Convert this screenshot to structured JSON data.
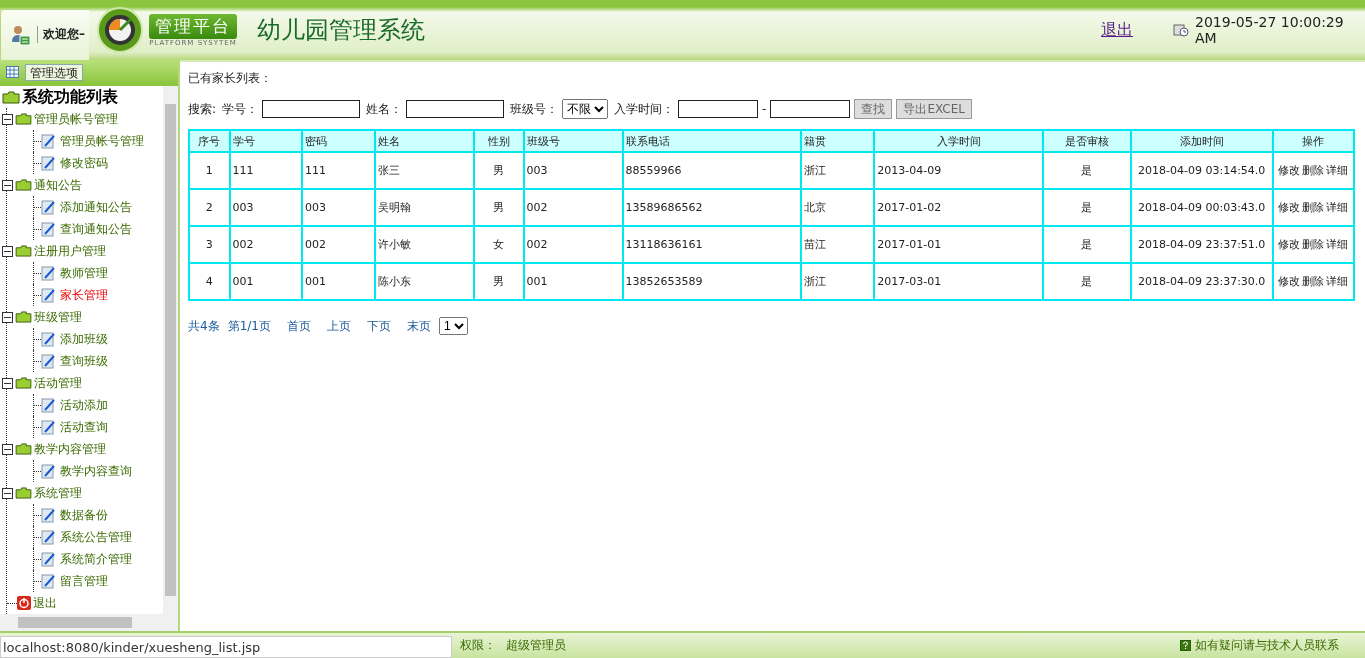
{
  "header": {
    "welcome": "欢迎您–",
    "logo_title": "管理平台",
    "logo_subtitle": "PLATFORM SYSYTEM",
    "app_title": "幼儿园管理系统",
    "logout": "退出",
    "datetime": "2019-05-27 10:00:29 AM"
  },
  "sidebar": {
    "tab": "管理选项",
    "tree": {
      "label": "系统功能列表",
      "children": [
        {
          "kind": "group",
          "label": "管理员帐号管理",
          "expanded": true,
          "children": [
            {
              "label": "管理员帐号管理",
              "selected": false
            },
            {
              "label": "修改密码",
              "selected": false
            }
          ]
        },
        {
          "kind": "group",
          "label": "通知公告",
          "expanded": true,
          "children": [
            {
              "label": "添加通知公告",
              "selected": false
            },
            {
              "label": "查询通知公告",
              "selected": false
            }
          ]
        },
        {
          "kind": "group",
          "label": "注册用户管理",
          "expanded": true,
          "children": [
            {
              "label": "教师管理",
              "selected": false
            },
            {
              "label": "家长管理",
              "selected": true
            }
          ]
        },
        {
          "kind": "group",
          "label": "班级管理",
          "expanded": true,
          "children": [
            {
              "label": "添加班级",
              "selected": false
            },
            {
              "label": "查询班级",
              "selected": false
            }
          ]
        },
        {
          "kind": "group",
          "label": "活动管理",
          "expanded": true,
          "children": [
            {
              "label": "活动添加",
              "selected": false
            },
            {
              "label": "活动查询",
              "selected": false
            }
          ]
        },
        {
          "kind": "group",
          "label": "教学内容管理",
          "expanded": true,
          "children": [
            {
              "label": "教学内容查询",
              "selected": false
            }
          ]
        },
        {
          "kind": "group",
          "label": "系统管理",
          "expanded": true,
          "children": [
            {
              "label": "数据备份",
              "selected": false
            },
            {
              "label": "系统公告管理",
              "selected": false
            },
            {
              "label": "系统简介管理",
              "selected": false
            },
            {
              "label": "留言管理",
              "selected": false
            }
          ]
        },
        {
          "kind": "exit",
          "label": "退出",
          "selected": false
        }
      ]
    }
  },
  "content": {
    "heading": "已有家长列表：",
    "search": {
      "label": "搜索:",
      "fields": [
        {
          "label": "学号：",
          "kind": "text"
        },
        {
          "label": "姓名：",
          "kind": "text"
        },
        {
          "label": "班级号：",
          "kind": "select",
          "value": "不限"
        },
        {
          "label": "入学时间：",
          "kind": "range",
          "separator": "-"
        }
      ],
      "buttons": [
        "查找",
        "导出EXCEL"
      ]
    },
    "table": {
      "columns": [
        "序号",
        "学号",
        "密码",
        "姓名",
        "性别",
        "班级号",
        "联系电话",
        "籍贯",
        "入学时间",
        "是否审核",
        "添加时间",
        "操作"
      ],
      "rows": [
        {
          "cells": [
            "1",
            "111",
            "111",
            "张三",
            "男",
            "003",
            "88559966",
            "浙江",
            "2013-04-09",
            "是",
            "2018-04-09 03:14:54.0"
          ],
          "actions": [
            "修改",
            "删除",
            "详细"
          ]
        },
        {
          "cells": [
            "2",
            "003",
            "003",
            "吴明翰",
            "男",
            "002",
            "13589686562",
            "北京",
            "2017-01-02",
            "是",
            "2018-04-09 00:03:43.0"
          ],
          "actions": [
            "修改",
            "删除",
            "详细"
          ]
        },
        {
          "cells": [
            "3",
            "002",
            "002",
            "许小敏",
            "女",
            "002",
            "13118636161",
            "苗江",
            "2017-01-01",
            "是",
            "2018-04-09 23:37:51.0"
          ],
          "actions": [
            "修改",
            "删除",
            "详细"
          ]
        },
        {
          "cells": [
            "4",
            "001",
            "001",
            "陈小东",
            "男",
            "001",
            "13852653589",
            "浙江",
            "2017-03-01",
            "是",
            "2018-04-09 23:37:30.0"
          ],
          "actions": [
            "修改",
            "删除",
            "详细"
          ]
        }
      ]
    },
    "pagination": {
      "total": "共4条",
      "page": "第1/1页",
      "links": [
        "首页",
        "上页",
        "下页",
        "末页"
      ],
      "page_select": "1"
    }
  },
  "status_bar": {
    "permission_label": "权限：",
    "permission_value": "超级管理员",
    "help": "如有疑问请与技术人员联系",
    "browser_url": "localhost:8080/kinder/xuesheng_list.jsp"
  }
}
